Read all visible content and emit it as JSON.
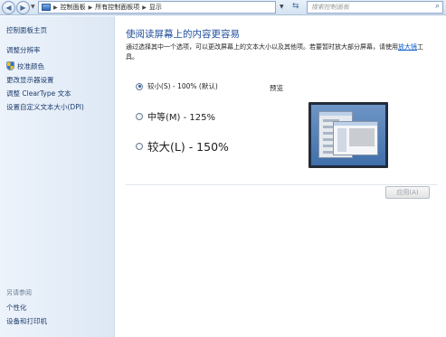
{
  "address_bar": {
    "back_glyph": "◀",
    "forward_glyph": "▶",
    "crumbs": [
      "控制面板",
      "所有控制面板项",
      "显示"
    ],
    "search_placeholder": "搜索控制面板"
  },
  "sidebar": {
    "items": [
      {
        "label": "控制面板主页"
      },
      {
        "label": "调整分辨率"
      },
      {
        "label": "校准颜色",
        "icon": "shield-icon"
      },
      {
        "label": "更改显示器设置"
      },
      {
        "label": "调整 ClearType 文本"
      },
      {
        "label": "设置自定义文本大小(DPI)"
      }
    ],
    "see_also_heading": "另请参阅",
    "see_also": [
      {
        "label": "个性化"
      },
      {
        "label": "设备和打印机"
      }
    ]
  },
  "main": {
    "title": "使阅读屏幕上的内容更容易",
    "description": "通过选择其中一个选项，可以更改屏幕上的文本大小以及其他项。若要暂时放大部分屏幕，请使用",
    "description_link": "放大镜",
    "description_suffix": "工具。",
    "options": [
      {
        "label": "较小(S) - 100% (默认)",
        "checked": true
      },
      {
        "label": "中等(M) - 125%",
        "checked": false
      },
      {
        "label": "较大(L) - 150%",
        "checked": false
      }
    ],
    "preview_label": "预览",
    "apply_label": "应用(A)"
  },
  "colors": {
    "title": "#1e4e9b",
    "link": "#0b5cc7",
    "sidebar_bg": "#e4edf8"
  }
}
